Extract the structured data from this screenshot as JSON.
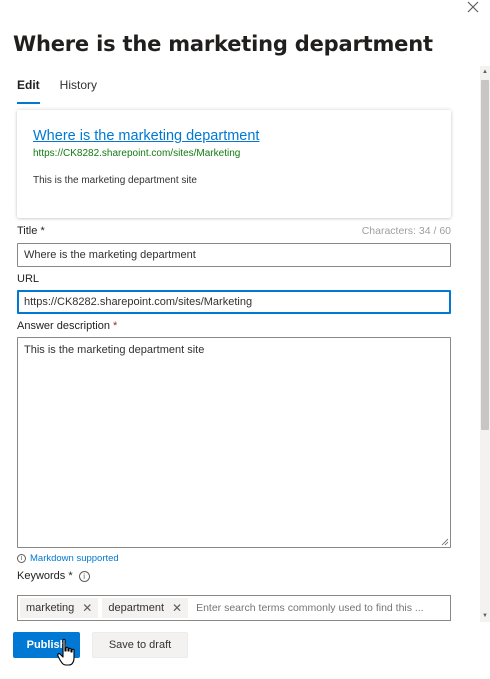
{
  "panel": {
    "title": "Where is the marketing department",
    "close_icon": "close-icon"
  },
  "tabs": [
    {
      "label": "Edit",
      "active": true
    },
    {
      "label": "History",
      "active": false
    }
  ],
  "preview": {
    "title": "Where is the marketing department",
    "url": "https://CK8282.sharepoint.com/sites/Marketing",
    "description": "This is the marketing department site"
  },
  "form": {
    "title_label": "Title",
    "required_marker": "*",
    "char_count": "Characters: 34 / 60",
    "title_value": "Where is the marketing department",
    "url_label": "URL",
    "url_value": "https://CK8282.sharepoint.com/sites/Marketing",
    "description_label": "Answer description",
    "description_value": "This is the marketing department site",
    "markdown_hint": "Markdown supported",
    "keywords_label": "Keywords",
    "keywords": [
      "marketing",
      "department"
    ],
    "keywords_placeholder": "Enter search terms commonly used to find this ..."
  },
  "footer": {
    "publish_label": "Publish",
    "draft_label": "Save to draft"
  },
  "colors": {
    "accent": "#0078d4",
    "url_green": "#107c10",
    "required_red": "#a4262c"
  }
}
